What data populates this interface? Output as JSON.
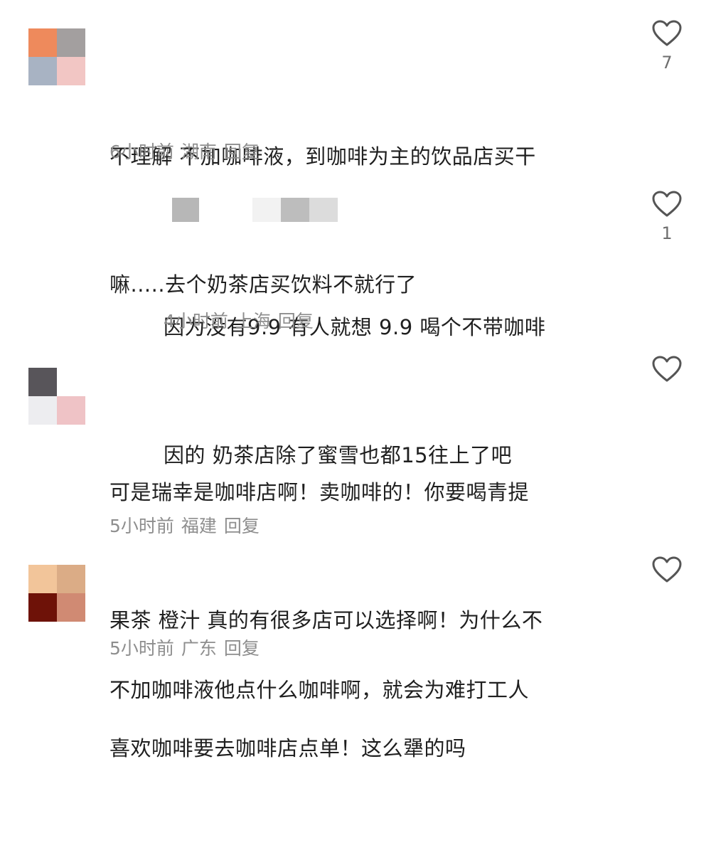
{
  "comments": [
    {
      "avatar_colors": [
        "#ee8a5c",
        "#a39f9f",
        "#a8b3c3",
        "#f2c6c4"
      ],
      "lines": [
        "不理解 不加咖啡液，到咖啡为主的饮品店买干",
        "嘛.....去个奶茶店买饮料不就行了"
      ],
      "time": "6小时前",
      "location": "湖南",
      "reply_label": "回复",
      "like_count": "7"
    },
    {
      "lines": [
        "因为没有9.9 有人就想 9.9 喝个不带咖啡",
        "因的 奶茶店除了蜜雪也都15往上了吧"
      ],
      "time": "4小时前",
      "location": "上海",
      "reply_label": "回复",
      "like_count": "1"
    },
    {
      "avatar_colors": [
        "#58555a",
        "#ffffff",
        "#ededf0",
        "#efc3c6"
      ],
      "lines": [
        "可是瑞幸是咖啡店啊！卖咖啡的！你要喝青提",
        "果茶 橙汁 真的有很多店可以选择啊！为什么不",
        "喜欢咖啡要去咖啡店点单！这么犟的吗"
      ],
      "time": "5小时前",
      "location": "福建",
      "reply_label": "回复",
      "like_count": ""
    },
    {
      "avatar_colors": [
        "#f2c59a",
        "#dbac86",
        "#6e1208",
        "#d08a73"
      ],
      "lines": [
        "不加咖啡液他点什么咖啡啊，就会为难打工人"
      ],
      "time": "5小时前",
      "location": "广东",
      "reply_label": "回复",
      "like_count": ""
    }
  ]
}
